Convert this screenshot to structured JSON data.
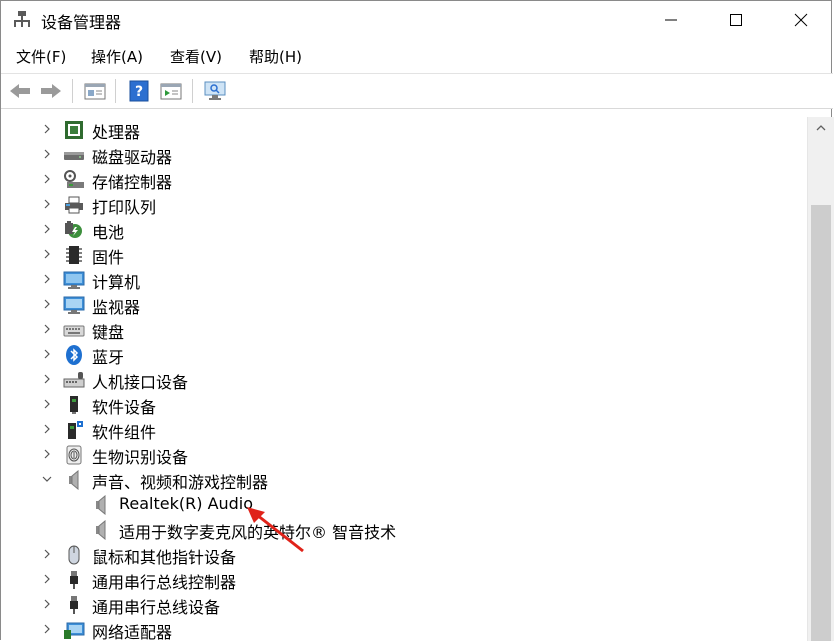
{
  "window": {
    "title": "设备管理器"
  },
  "menu": [
    "文件(F)",
    "操作(A)",
    "查看(V)",
    "帮助(H)"
  ],
  "toolbar": {
    "buttons": [
      "back-arrow-icon",
      "forward-arrow-icon",
      "properties-icon",
      "help-icon",
      "update-driver-icon",
      "scan-hardware-icon"
    ]
  },
  "tree": {
    "categories": [
      "处理器",
      "磁盘驱动器",
      "存储控制器",
      "打印队列",
      "电池",
      "固件",
      "计算机",
      "监视器",
      "键盘",
      "蓝牙",
      "人机接口设备",
      "软件设备",
      "软件组件",
      "生物识别设备",
      "声音、视频和游戏控制器",
      "鼠标和其他指针设备",
      "通用串行总线控制器",
      "通用串行总线设备",
      "网络适配器"
    ],
    "expanded_children": [
      "Realtek(R) Audio",
      "适用于数字麦克风的英特尔® 智音技术"
    ]
  },
  "colors": {
    "annotation_arrow": "#e0231a",
    "accent_blue": "#1e70d0"
  }
}
